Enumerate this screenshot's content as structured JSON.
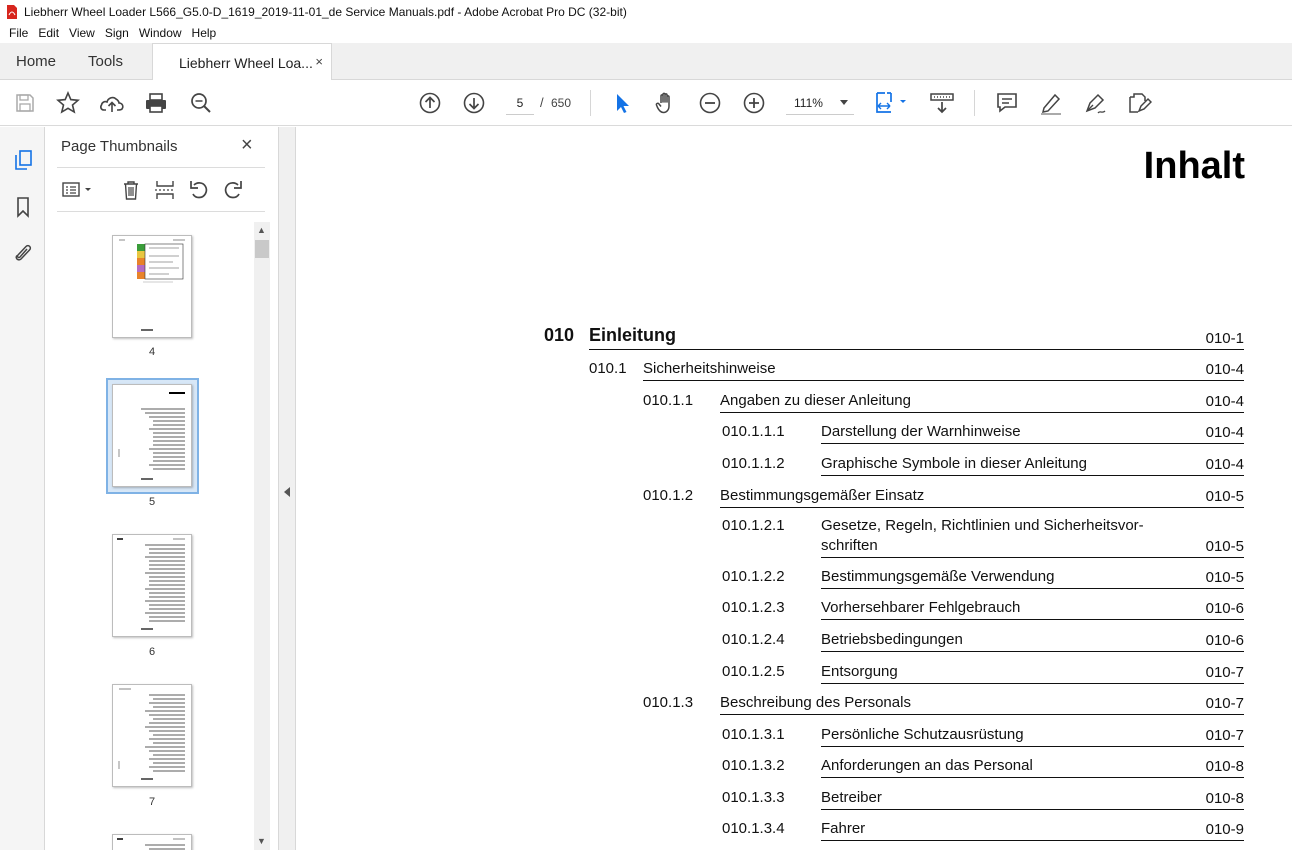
{
  "window": {
    "title": "Liebherr Wheel Loader L566_G5.0-D_1619_2019-11-01_de Service Manuals.pdf - Adobe Acrobat Pro DC (32-bit)"
  },
  "menu": [
    "File",
    "Edit",
    "View",
    "Sign",
    "Window",
    "Help"
  ],
  "tabs": {
    "home": "Home",
    "tools": "Tools",
    "document": "Liebherr Wheel Loa...",
    "close": "×"
  },
  "toolbar": {
    "current_page": "5",
    "separator": "/",
    "total_pages": "650",
    "zoom": "111%"
  },
  "panel": {
    "title": "Page Thumbnails",
    "close": "×",
    "thumbnails": [
      {
        "page": "4",
        "selected": false
      },
      {
        "page": "5",
        "selected": true
      },
      {
        "page": "6",
        "selected": false
      },
      {
        "page": "7",
        "selected": false
      }
    ]
  },
  "document": {
    "heading": "Inhalt",
    "toc": [
      {
        "level": 0,
        "number": "010",
        "title": "Einleitung",
        "page": "010-1"
      },
      {
        "level": 1,
        "number": "010.1",
        "title": "Sicherheitshinweise",
        "page": "010-4"
      },
      {
        "level": 2,
        "number": "010.1.1",
        "title": "Angaben zu dieser Anleitung",
        "page": "010-4"
      },
      {
        "level": 3,
        "number": "010.1.1.1",
        "title": "Darstellung der Warnhinweise",
        "page": "010-4"
      },
      {
        "level": 3,
        "number": "010.1.1.2",
        "title": "Graphische Symbole in dieser Anleitung",
        "page": "010-4"
      },
      {
        "level": 2,
        "number": "010.1.2",
        "title": "Bestimmungsgemäßer Einsatz",
        "page": "010-5"
      },
      {
        "level": 3,
        "number": "010.1.2.1",
        "title": "Gesetze, Regeln, Richtlinien und Sicherheitsvor-",
        "title2": "schriften",
        "page": "010-5"
      },
      {
        "level": 3,
        "number": "010.1.2.2",
        "title": "Bestimmungsgemäße Verwendung",
        "page": "010-5"
      },
      {
        "level": 3,
        "number": "010.1.2.3",
        "title": "Vorhersehbarer Fehlgebrauch",
        "page": "010-6"
      },
      {
        "level": 3,
        "number": "010.1.2.4",
        "title": "Betriebsbedingungen",
        "page": "010-6"
      },
      {
        "level": 3,
        "number": "010.1.2.5",
        "title": "Entsorgung",
        "page": "010-7"
      },
      {
        "level": 2,
        "number": "010.1.3",
        "title": "Beschreibung des Personals",
        "page": "010-7"
      },
      {
        "level": 3,
        "number": "010.1.3.1",
        "title": "Persönliche Schutzausrüstung",
        "page": "010-7"
      },
      {
        "level": 3,
        "number": "010.1.3.2",
        "title": "Anforderungen an das Personal",
        "page": "010-8"
      },
      {
        "level": 3,
        "number": "010.1.3.3",
        "title": "Betreiber",
        "page": "010-8"
      },
      {
        "level": 3,
        "number": "010.1.3.4",
        "title": "Fahrer",
        "page": "010-9"
      }
    ]
  },
  "colors": {
    "accent": "#1473e6",
    "selection": "#d7e7f7"
  }
}
